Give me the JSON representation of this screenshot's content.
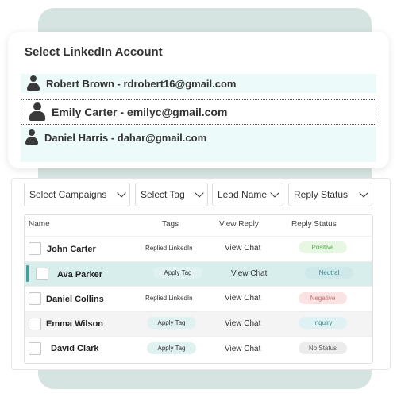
{
  "accounts": {
    "title": "Select LinkedIn Account",
    "items": [
      {
        "label": "Robert Brown - rdrobert16@gmail.com"
      },
      {
        "label": "Emily Carter - emilyc@gmail.com"
      },
      {
        "label": "Daniel Harris - dahar@gmail.com"
      }
    ]
  },
  "filters": [
    {
      "label": "Select Campaigns"
    },
    {
      "label": "Select Tag"
    },
    {
      "label": "Lead Name"
    },
    {
      "label": "Reply Status"
    }
  ],
  "table": {
    "headers": [
      "Name",
      "Tags",
      "View Reply",
      "Reply Status"
    ],
    "rows": [
      {
        "name": "John Carter",
        "tag": "Replied LinkedIn",
        "reply": "View Chat",
        "status": "Positive",
        "status_color": "#e8f7e4",
        "status_text_color": "#5aa552"
      },
      {
        "name": "Ava Parker",
        "tag": "Apply Tag",
        "reply": "View Chat",
        "status": "Neutral",
        "status_color": "#cfe8ea",
        "status_text_color": "#3f8a92"
      },
      {
        "name": "Daniel Collins",
        "tag": "Replied LinkedIn",
        "reply": "View Chat",
        "status": "Negative",
        "status_color": "#fbe3e3",
        "status_text_color": "#c46a6a"
      },
      {
        "name": "Emma Wilson",
        "tag": "Apply Tag",
        "reply": "View Chat",
        "status": "Inquiry",
        "status_color": "#dff1f3",
        "status_text_color": "#3f8a92"
      },
      {
        "name": "David Clark",
        "tag": "Apply Tag",
        "reply": "View Chat",
        "status": "No Status",
        "status_color": "#ececec",
        "status_text_color": "#555555"
      }
    ]
  },
  "icons": {
    "person": "person-icon",
    "chevron": "chevron-down-icon",
    "checkbox": "checkbox"
  },
  "colors": {
    "accent": "#3aa3a0",
    "background_card": "#d5e3e1",
    "account_highlight": "#edfafa"
  }
}
